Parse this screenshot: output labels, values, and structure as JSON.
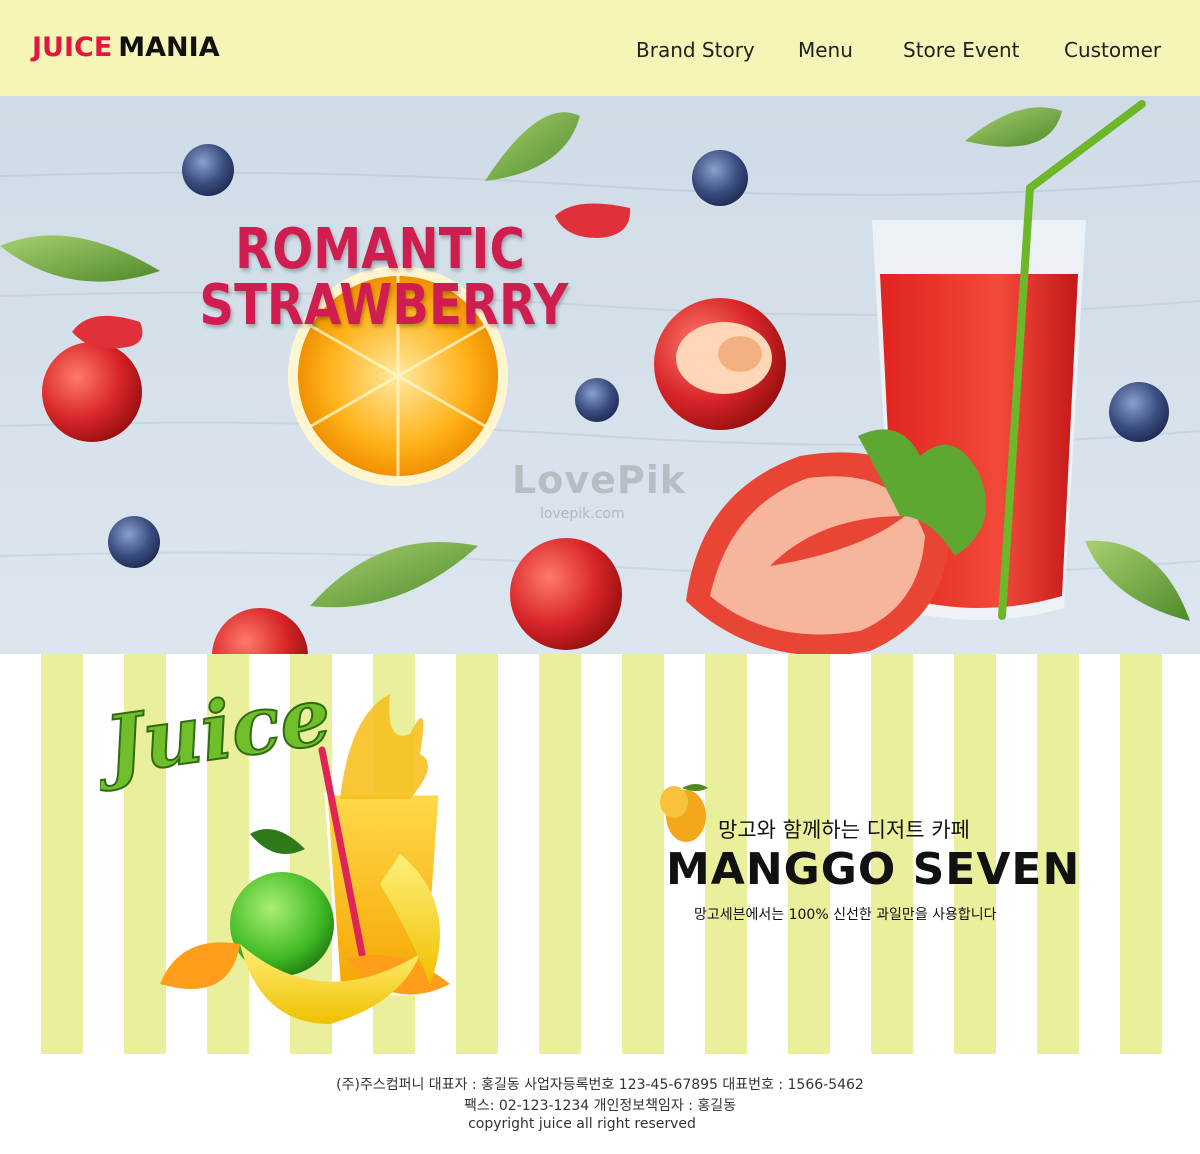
{
  "header": {
    "logo_part1": "JUICE",
    "logo_part2": "MANIA",
    "nav": [
      "Brand Story",
      "Menu",
      "Store Event",
      "Customer"
    ]
  },
  "hero": {
    "title_line1": "ROMANTIC",
    "title_line2": "STRAWBERRY",
    "watermark": "LovePik",
    "watermark_url": "lovepik.com"
  },
  "promo": {
    "juice_logo": "Juice",
    "subtitle": "망고와 함께하는 디저트 카페",
    "title": "MANGGO SEVEN",
    "description": "망고세븐에서는 100% 신선한 과일만을 사용합니다"
  },
  "footer": {
    "line1": "(주)주스컴퍼니 대표자 : 홍길동  사업자등록번호 123-45-67895 대표번호 : 1566-5462",
    "line2": "팩스: 02-123-1234  개인정보책임자 : 홍길동",
    "line3": "copyright juice all right reserved"
  },
  "colors": {
    "header_bg": "#f6f5b8",
    "logo_red": "#e0183f",
    "stripe_yellow": "#eaef9c",
    "hero_title": "#cf1d4f"
  }
}
